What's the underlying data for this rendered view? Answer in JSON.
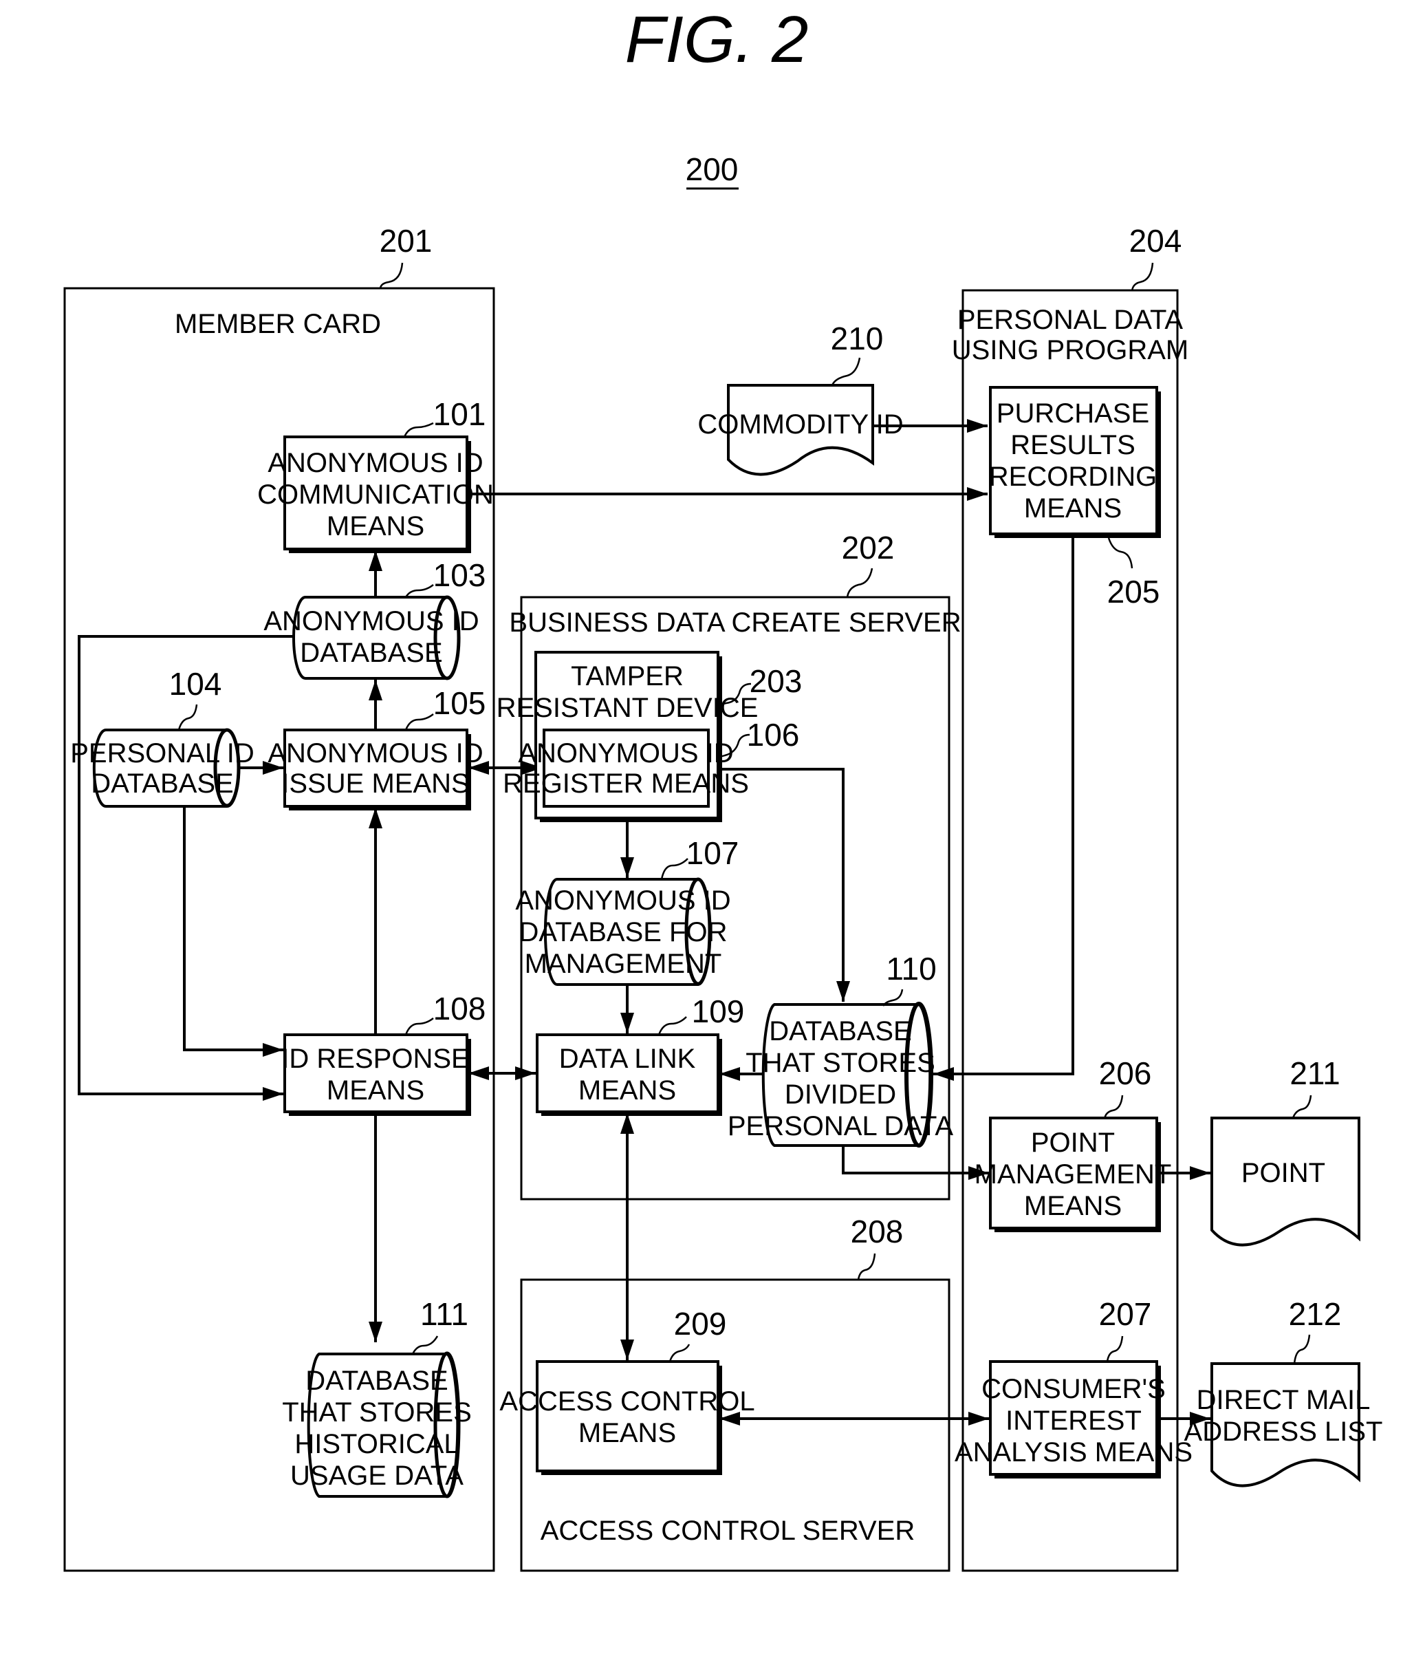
{
  "figure": {
    "title": "FIG. 2",
    "system_ref": "200"
  },
  "containers": {
    "member_card": {
      "ref": "201",
      "label": "MEMBER CARD"
    },
    "business_server": {
      "ref": "202",
      "label": "BUSINESS DATA CREATE SERVER"
    },
    "personal_program": {
      "ref": "204",
      "label_lines": [
        "PERSONAL DATA",
        "USING PROGRAM"
      ]
    },
    "access_server": {
      "ref": "208",
      "label": "ACCESS CONTROL SERVER"
    },
    "tamper_device": {
      "ref": "203",
      "label_lines": [
        "TAMPER",
        "RESISTANT DEVICE"
      ]
    }
  },
  "blocks": {
    "b101": {
      "ref": "101",
      "lines": [
        "ANONYMOUS ID",
        "COMMUNICATION",
        "MEANS"
      ]
    },
    "b103": {
      "ref": "103",
      "lines": [
        "ANONYMOUS ID",
        "DATABASE"
      ]
    },
    "b104": {
      "ref": "104",
      "lines": [
        "PERSONAL ID",
        "DATABASE"
      ]
    },
    "b105": {
      "ref": "105",
      "lines": [
        "ANONYMOUS ID",
        "ISSUE MEANS"
      ]
    },
    "b106": {
      "ref": "106",
      "lines": [
        "ANONYMOUS ID",
        "REGISTER MEANS"
      ]
    },
    "b107": {
      "ref": "107",
      "lines": [
        "ANONYMOUS ID",
        "DATABASE FOR",
        "MANAGEMENT"
      ]
    },
    "b108": {
      "ref": "108",
      "lines": [
        "ID RESPONSE",
        "MEANS"
      ]
    },
    "b109": {
      "ref": "109",
      "lines": [
        "DATA LINK",
        "MEANS"
      ]
    },
    "b110": {
      "ref": "110",
      "lines": [
        "DATABASE",
        "THAT STORES",
        "DIVIDED",
        "PERSONAL DATA"
      ]
    },
    "b111": {
      "ref": "111",
      "lines": [
        "DATABASE",
        "THAT STORES",
        "HISTORICAL",
        "USAGE DATA"
      ]
    },
    "b205": {
      "ref": "205",
      "lines": [
        "PURCHASE",
        "RESULTS",
        "RECORDING",
        "MEANS"
      ]
    },
    "b206": {
      "ref": "206",
      "lines": [
        "POINT",
        "MANAGEMENT",
        "MEANS"
      ]
    },
    "b207": {
      "ref": "207",
      "lines": [
        "CONSUMER'S",
        "INTEREST",
        "ANALYSIS MEANS"
      ]
    },
    "b209": {
      "ref": "209",
      "lines": [
        "ACCESS CONTROL",
        "MEANS"
      ]
    },
    "b210": {
      "ref": "210",
      "lines": [
        "COMMODITY ID"
      ]
    },
    "b211": {
      "ref": "211",
      "lines": [
        "POINT"
      ]
    },
    "b212": {
      "ref": "212",
      "lines": [
        "DIRECT MAIL",
        "ADDRESS LIST"
      ]
    }
  }
}
